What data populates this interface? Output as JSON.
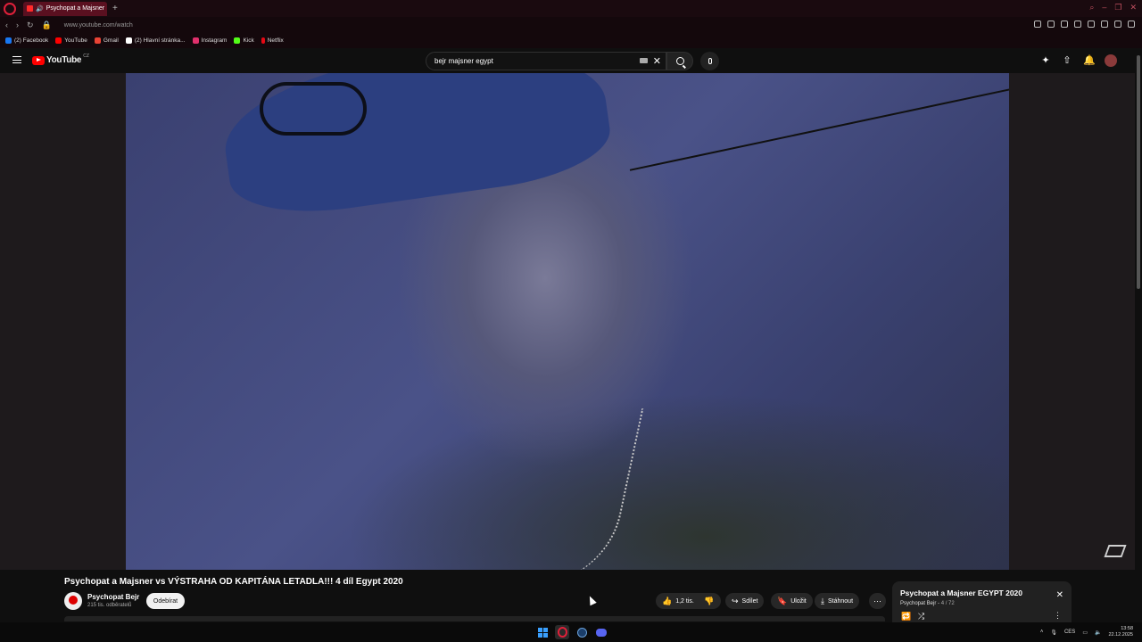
{
  "browser": {
    "tab_title": "Psychopat a Majsner",
    "url": "www.youtube.com/watch",
    "bookmarks": [
      {
        "label": "(2) Facebook",
        "icon": "facebook-icon",
        "color": "#1877f2"
      },
      {
        "label": "YouTube",
        "icon": "youtube-icon",
        "color": "#ff0000"
      },
      {
        "label": "Gmail",
        "icon": "gmail-icon",
        "color": "#ea4335"
      },
      {
        "label": "(2) Hlavní stránka...",
        "icon": "x-icon",
        "color": "#ffffff"
      },
      {
        "label": "Instagram",
        "icon": "instagram-icon",
        "color": "#e1306c"
      },
      {
        "label": "Kick",
        "icon": "kick-icon",
        "color": "#53fc18"
      },
      {
        "label": "Netflix",
        "icon": "netflix-icon",
        "color": "#e50914"
      }
    ]
  },
  "youtube": {
    "logo_text": "YouTube",
    "country_code": "CZ",
    "search_value": "bejr majsner egypt"
  },
  "video": {
    "title": "Psychopat a Majsner vs VÝSTRAHA OD KAPITÁNA LETADLA!!! 4 díl Egypt 2020",
    "channel_name": "Psychopat Bejr",
    "subscribers": "215 tis. odběratelů",
    "subscribe_label": "Odebírat",
    "likes": "1,2 tis.",
    "share_label": "Sdílet",
    "save_label": "Uložit",
    "download_label": "Stáhnout"
  },
  "playlist": {
    "title": "Psychopat a Majsner EGYPT 2020",
    "owner": "Psychopat Bejr",
    "position": "4 / 72"
  },
  "taskbar": {
    "language": "CES",
    "time": "13:58",
    "date": "22.12.2025"
  },
  "colors": {
    "accent": "#ff0000",
    "opera_red": "#e0203a",
    "background": "#0f0f0f"
  }
}
